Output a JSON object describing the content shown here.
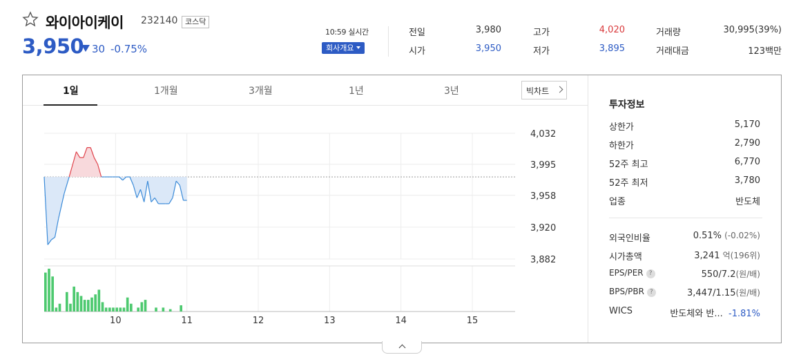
{
  "stock": {
    "name": "와이아이케이",
    "code": "232140",
    "market": "코스닥",
    "price": "3,950",
    "change": "30",
    "change_rate": "-0.75%",
    "realtime": "10:59 실시간",
    "company_btn": "회사개요",
    "favorite_icon": "star-outline-icon"
  },
  "quote": [
    {
      "label": "전일",
      "value": "3,980",
      "color": "#333333"
    },
    {
      "label": "시가",
      "value": "3,950",
      "color": "#2d5bc4"
    },
    {
      "label": "고가",
      "value": "4,020",
      "color": "#d9393b"
    },
    {
      "label": "저가",
      "value": "3,895",
      "color": "#2d5bc4"
    },
    {
      "label": "거래량",
      "value": "30,995(39%)",
      "color": "#333333"
    },
    {
      "label": "거래대금",
      "value": "123백만",
      "color": "#333333"
    }
  ],
  "tabs": [
    "1일",
    "1개월",
    "3개월",
    "1년",
    "3년"
  ],
  "active_tab": "1일",
  "big_chart": "빅차트",
  "chart_data": {
    "type": "line",
    "x_ticks": [
      "10",
      "11",
      "12",
      "13",
      "14",
      "15"
    ],
    "y_ticks": [
      "4,032",
      "3,995",
      "3,958",
      "3,920",
      "3,882"
    ],
    "ylim": [
      3882,
      4032
    ],
    "baseline": 3980,
    "x_range": [
      9.0,
      15.6
    ],
    "price": {
      "x": [
        9.0,
        9.05,
        9.1,
        9.15,
        9.2,
        9.28,
        9.35,
        9.4,
        9.45,
        9.5,
        9.55,
        9.6,
        9.65,
        9.7,
        9.75,
        9.8,
        9.85,
        9.9,
        9.95,
        10.0,
        10.05,
        10.1,
        10.15,
        10.2,
        10.25,
        10.3,
        10.35,
        10.4,
        10.45,
        10.5,
        10.55,
        10.6,
        10.65,
        10.7,
        10.75,
        10.8,
        10.85,
        10.9,
        10.95,
        11.0
      ],
      "y": [
        3980,
        3899,
        3905,
        3908,
        3930,
        3960,
        3980,
        3995,
        4010,
        4003,
        4003,
        4015,
        4015,
        4003,
        3995,
        3980,
        3980,
        3980,
        3980,
        3980,
        3980,
        3976,
        3980,
        3980,
        3970,
        3955,
        3965,
        3950,
        3975,
        3950,
        3955,
        3948,
        3948,
        3948,
        3948,
        3955,
        3975,
        3970,
        3952,
        3952
      ]
    },
    "volume": {
      "x": [
        9.0,
        9.05,
        9.1,
        9.15,
        9.2,
        9.3,
        9.35,
        9.4,
        9.45,
        9.5,
        9.55,
        9.6,
        9.65,
        9.7,
        9.75,
        9.8,
        9.85,
        9.9,
        9.95,
        10.0,
        10.05,
        10.1,
        10.15,
        10.2,
        10.3,
        10.35,
        10.4,
        10.55,
        10.65,
        10.75,
        10.9
      ],
      "v": [
        50,
        55,
        45,
        5,
        10,
        25,
        10,
        32,
        25,
        20,
        15,
        15,
        18,
        22,
        28,
        12,
        5,
        5,
        5,
        5,
        5,
        5,
        18,
        10,
        5,
        12,
        15,
        5,
        5,
        3,
        8
      ]
    }
  },
  "invest_info": {
    "title": "투자정보",
    "rows": [
      {
        "label": "상한가",
        "value": "5,170",
        "color": "#d9393b"
      },
      {
        "label": "하한가",
        "value": "2,790",
        "color": "#2d5bc4"
      },
      {
        "label": "52주 최고",
        "value": "6,770",
        "color": "#333333"
      },
      {
        "label": "52주 최저",
        "value": "3,780",
        "color": "#333333"
      },
      {
        "label": "업종",
        "value": "반도체",
        "color": "#333333"
      }
    ],
    "rows2": [
      {
        "label": "외국인비율",
        "value": "0.51%",
        "sub": "(-0.02%)"
      },
      {
        "label": "시가총액",
        "value": "3,241",
        "sub": "억(196위)"
      },
      {
        "label": "EPS/PER",
        "value": "550/7.2",
        "sub": "(원/배)",
        "help": "?"
      },
      {
        "label": "BPS/PBR",
        "value": "3,447/1.15",
        "sub": "(원/배)",
        "help": "?"
      }
    ],
    "wics": {
      "label": "WICS",
      "value": "반도체와 반...",
      "rate": "-1.81%"
    }
  }
}
